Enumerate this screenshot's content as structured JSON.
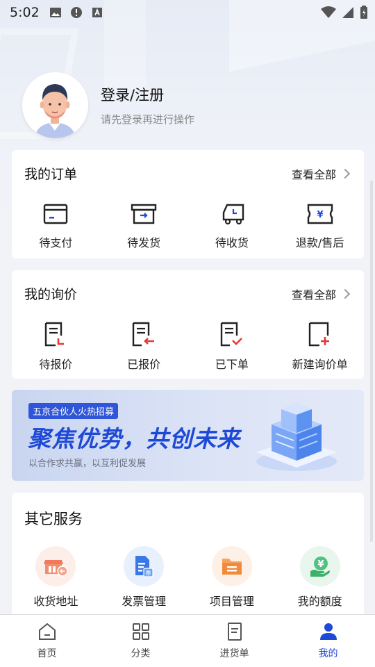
{
  "status_bar": {
    "time": "5:02"
  },
  "profile": {
    "title": "登录/注册",
    "subtitle": "请先登录再进行操作"
  },
  "orders": {
    "title": "我的订单",
    "view_all": "查看全部",
    "items": [
      {
        "label": "待支付",
        "icon": "wallet-icon"
      },
      {
        "label": "待发货",
        "icon": "box-ship-icon"
      },
      {
        "label": "待收货",
        "icon": "truck-icon"
      },
      {
        "label": "退款/售后",
        "icon": "refund-icon"
      }
    ]
  },
  "inquiry": {
    "title": "我的询价",
    "view_all": "查看全部",
    "items": [
      {
        "label": "待报价",
        "icon": "doc-pending-icon"
      },
      {
        "label": "已报价",
        "icon": "doc-quoted-icon"
      },
      {
        "label": "已下单",
        "icon": "doc-ordered-icon"
      },
      {
        "label": "新建询价单",
        "icon": "doc-new-icon"
      }
    ]
  },
  "banner": {
    "tag": "五京合伙人火热招募",
    "title": "聚焦优势，共创未来",
    "subtitle": "以合作求共赢，以互利促发展"
  },
  "services": {
    "title": "其它服务",
    "items": [
      {
        "label": "收货地址",
        "icon": "store-icon",
        "color": "#f07a5a"
      },
      {
        "label": "发票管理",
        "icon": "invoice-icon",
        "color": "#3b78e7"
      },
      {
        "label": "项目管理",
        "icon": "folder-icon",
        "color": "#f28a3c"
      },
      {
        "label": "我的额度",
        "icon": "credit-icon",
        "color": "#3db16b"
      }
    ]
  },
  "tabs": [
    {
      "label": "首页",
      "icon": "home-icon"
    },
    {
      "label": "分类",
      "icon": "grid-icon"
    },
    {
      "label": "进货单",
      "icon": "list-doc-icon"
    },
    {
      "label": "我的",
      "icon": "person-icon",
      "active": true
    }
  ],
  "accent_color": "#1e49d6"
}
